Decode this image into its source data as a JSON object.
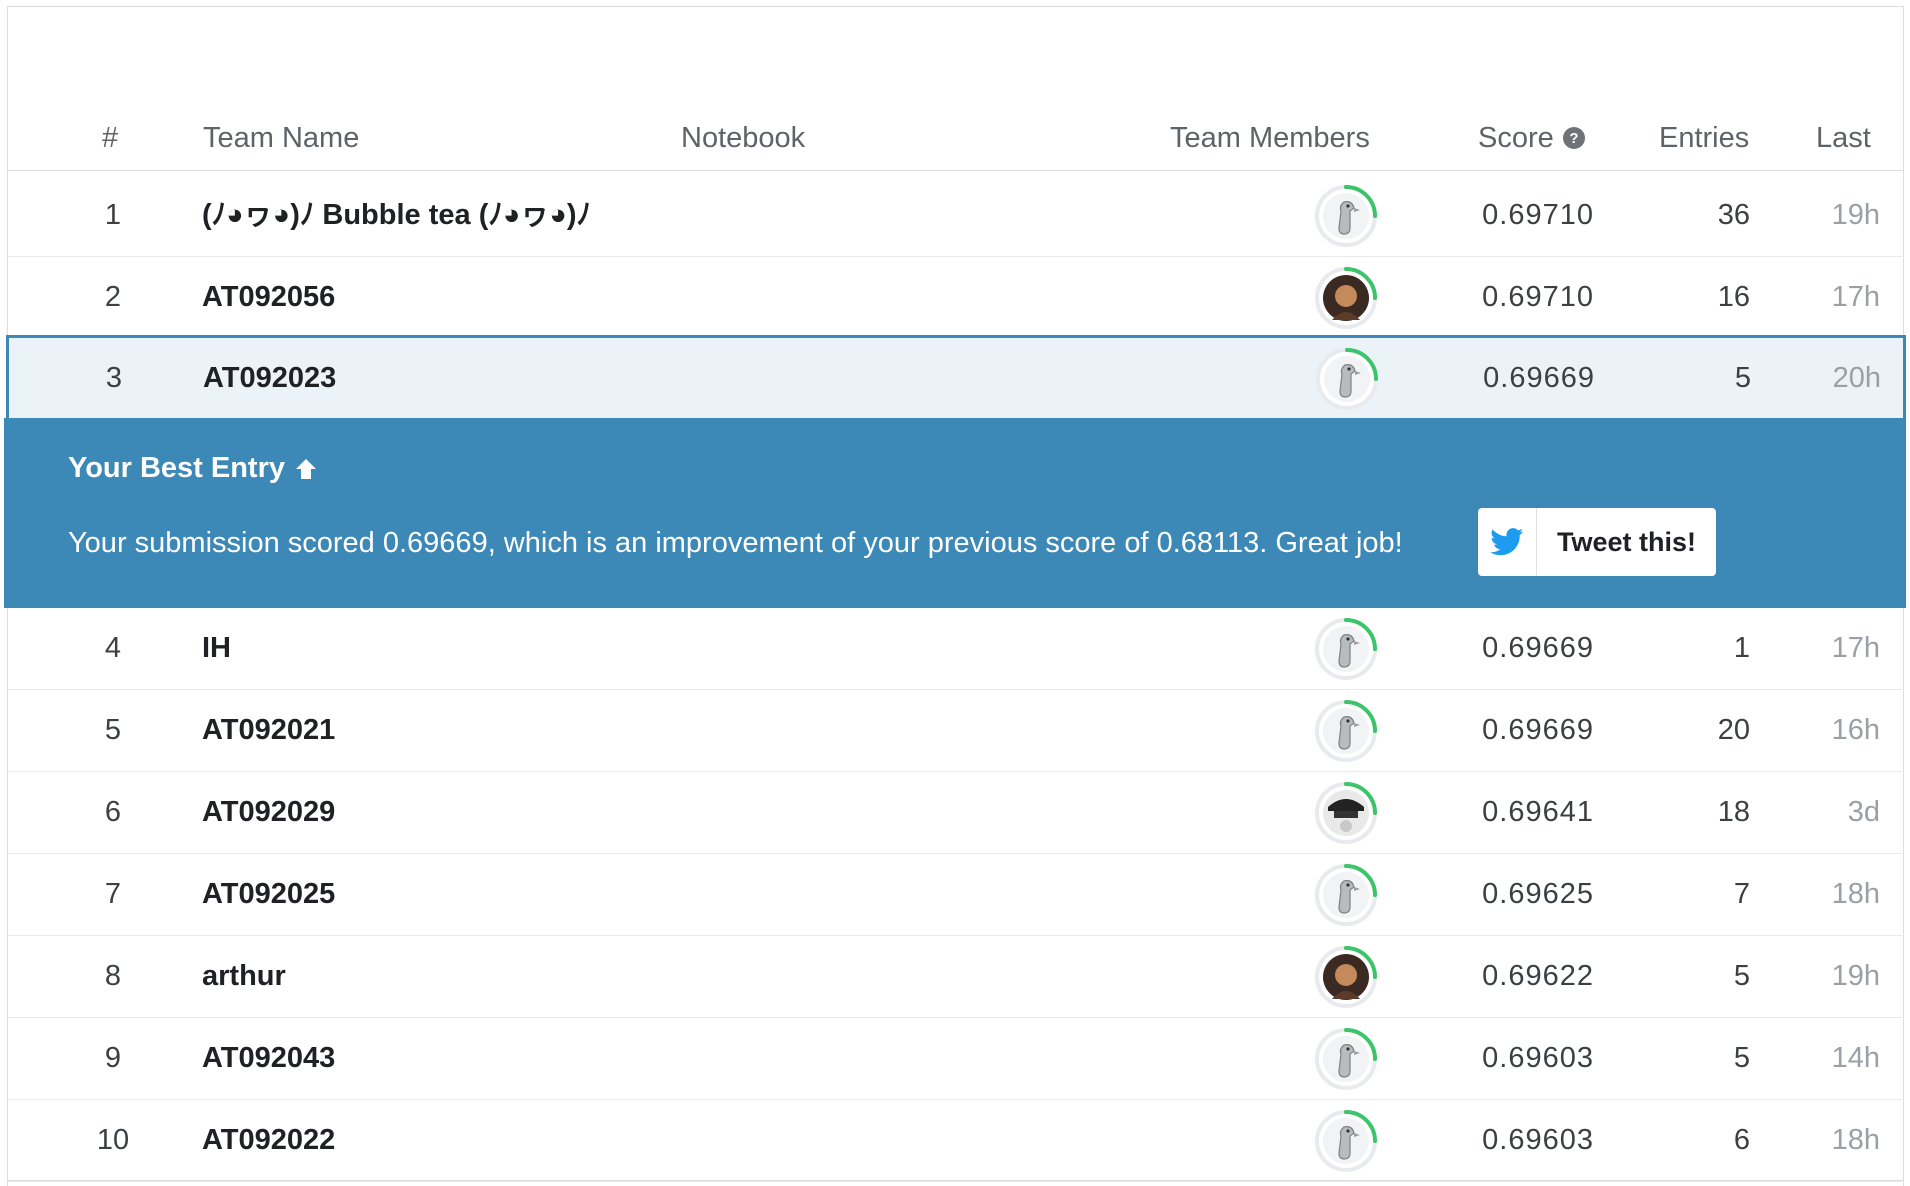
{
  "header": {
    "rank": "#",
    "team_name": "Team Name",
    "notebook": "Notebook",
    "team_members": "Team Members",
    "score": "Score",
    "entries": "Entries",
    "last": "Last"
  },
  "rows_top": [
    {
      "rank": "1",
      "team": "(ﾉ◕ヮ◕)ﾉ Bubble tea (ﾉ◕ヮ◕)ﾉ",
      "score": "0.69710",
      "entries": "36",
      "last": "19h",
      "avatar": "default-goose-icon"
    },
    {
      "rank": "2",
      "team": "AT092056",
      "score": "0.69710",
      "entries": "16",
      "last": "17h",
      "avatar": "photo-user-icon"
    },
    {
      "rank": "3",
      "team": "AT092023",
      "score": "0.69669",
      "entries": "5",
      "last": "20h",
      "avatar": "default-goose-icon"
    }
  ],
  "banner": {
    "title": "Your Best Entry",
    "message": "Your submission scored 0.69669, which is an improvement of your previous score of 0.68113. Great job!",
    "tweet_label": "Tweet this!"
  },
  "rows_bottom": [
    {
      "rank": "4",
      "team": "IH",
      "score": "0.69669",
      "entries": "1",
      "last": "17h",
      "avatar": "default-goose-icon"
    },
    {
      "rank": "5",
      "team": "AT092021",
      "score": "0.69669",
      "entries": "20",
      "last": "16h",
      "avatar": "default-goose-icon"
    },
    {
      "rank": "6",
      "team": "AT092029",
      "score": "0.69641",
      "entries": "18",
      "last": "3d",
      "avatar": "cartoon-user-icon"
    },
    {
      "rank": "7",
      "team": "AT092025",
      "score": "0.69625",
      "entries": "7",
      "last": "18h",
      "avatar": "default-goose-icon"
    },
    {
      "rank": "8",
      "team": "arthur",
      "score": "0.69622",
      "entries": "5",
      "last": "19h",
      "avatar": "photo-user-icon"
    },
    {
      "rank": "9",
      "team": "AT092043",
      "score": "0.69603",
      "entries": "5",
      "last": "14h",
      "avatar": "default-goose-icon"
    },
    {
      "rank": "10",
      "team": "AT092022",
      "score": "0.69603",
      "entries": "6",
      "last": "18h",
      "avatar": "default-goose-icon"
    }
  ],
  "colors": {
    "banner": "#3c88b7",
    "highlight_row": "#ebf2f8",
    "progress_ring": "#3cc46a"
  }
}
